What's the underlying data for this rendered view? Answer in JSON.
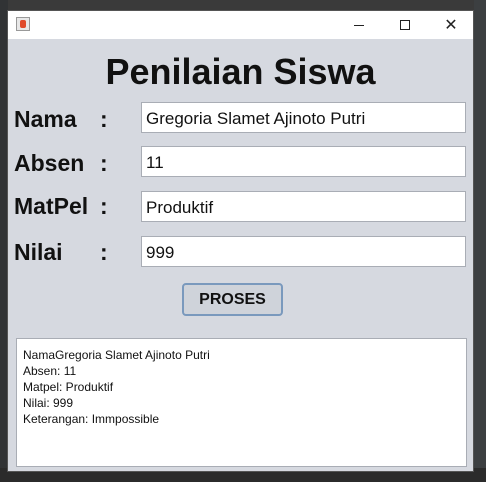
{
  "window": {
    "title": "",
    "controls": {
      "minimize": "minimize",
      "maximize": "maximize",
      "close": "✕"
    }
  },
  "form": {
    "heading": "Penilaian Siswa",
    "fields": [
      {
        "label": "Nama",
        "colon": ":",
        "value": "Gregoria Slamet Ajinoto Putri"
      },
      {
        "label": "Absen",
        "colon": ":",
        "value": "11"
      },
      {
        "label": "MatPel",
        "colon": ":",
        "value": "Produktif"
      },
      {
        "label": "Nilai",
        "colon": ":",
        "value": "999"
      }
    ],
    "button_label": "PROSES"
  },
  "output": {
    "lines": [
      "NamaGregoria Slamet Ajinoto Putri",
      "Absen: 11",
      "Matpel: Produktif",
      "Nilai: 999",
      "Keterangan: Immpossible"
    ]
  }
}
